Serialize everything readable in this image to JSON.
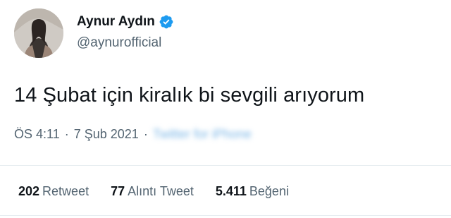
{
  "user": {
    "display_name": "Aynur Aydın",
    "handle": "@aynurofficial",
    "verified": true,
    "verified_color": "#1d9bf0",
    "avatar_icon": "profile-photo"
  },
  "tweet": {
    "text": "14 Şubat için kiralık bi sevgili arıyorum",
    "time": "ÖS 4:11",
    "separator": "·",
    "date": "7 Şub 2021",
    "source": "Twitter for iPhone"
  },
  "stats": {
    "retweets": {
      "count": "202",
      "label": "Retweet"
    },
    "quotes": {
      "count": "77",
      "label": "Alıntı Tweet"
    },
    "likes": {
      "count": "5.411",
      "label": "Beğeni"
    }
  },
  "colors": {
    "text": "#0f1419",
    "secondary": "#536471",
    "link_blurred": "#7bb6e6",
    "divider": "#e6ecf0"
  }
}
